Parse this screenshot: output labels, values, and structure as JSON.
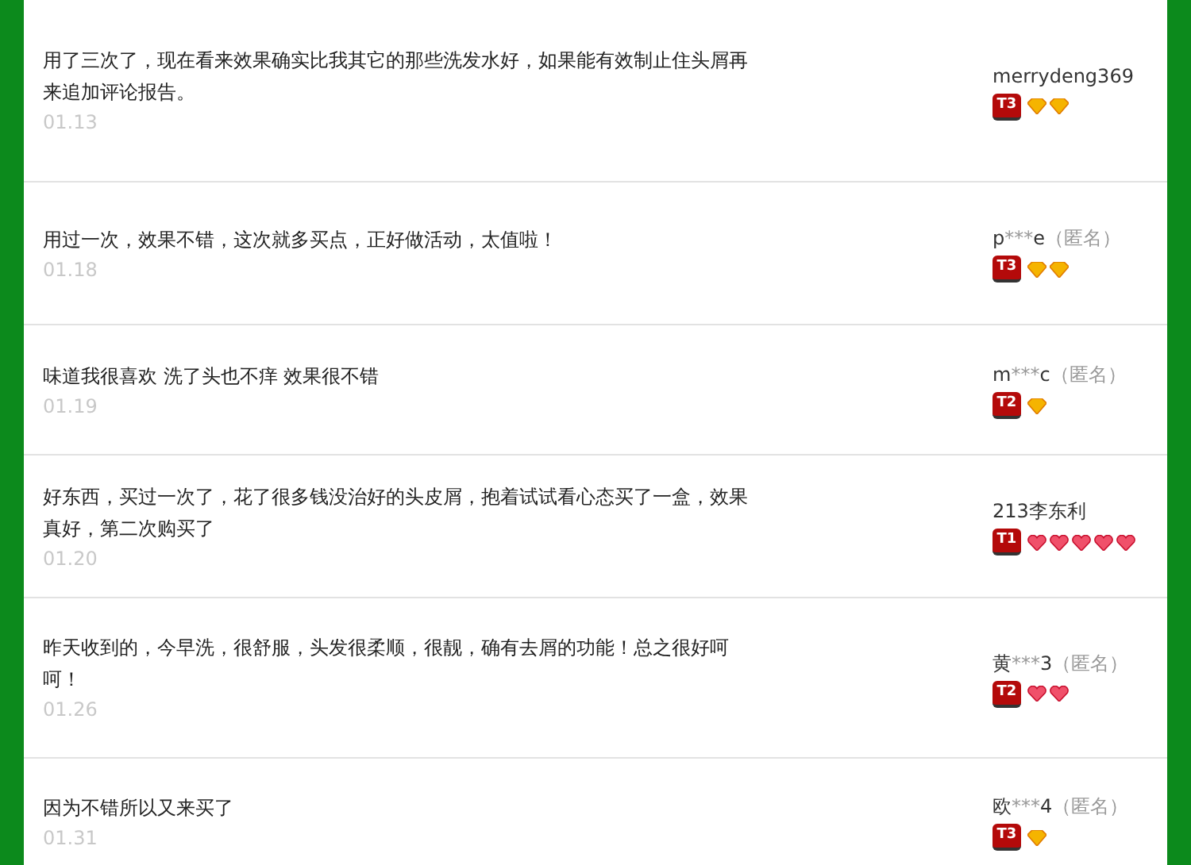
{
  "reviews": [
    {
      "text": "用了三次了，现在看来效果确实比我其它的那些洗发水好，如果能有效制止住头屑再来追加评论报告。",
      "date": "01.13",
      "user": {
        "name": "merrydeng369"
      },
      "badge": "T3",
      "credit_icons": [
        {
          "kind": "diamond"
        },
        {
          "kind": "diamond"
        }
      ]
    },
    {
      "text": "用过一次，效果不错，这次就多买点，正好做活动，太值啦！",
      "date": "01.18",
      "user": {
        "name": "p",
        "mask": "***",
        "name_end": "e",
        "anonymous": "（匿名）"
      },
      "badge": "T3",
      "credit_icons": [
        {
          "kind": "diamond"
        },
        {
          "kind": "diamond"
        }
      ]
    },
    {
      "text": "味道我很喜欢 洗了头也不痒 效果很不错",
      "date": "01.19",
      "user": {
        "name": "m",
        "mask": "***",
        "name_end": "c",
        "anonymous": "（匿名）"
      },
      "badge": "T2",
      "credit_icons": [
        {
          "kind": "diamond"
        }
      ]
    },
    {
      "text": "好东西，买过一次了，花了很多钱没治好的头皮屑，抱着试试看心态买了一盒，效果真好，第二次购买了",
      "date": "01.20",
      "user": {
        "name": "213李东利"
      },
      "badge": "T1",
      "credit_icons": [
        {
          "kind": "heart"
        },
        {
          "kind": "heart"
        },
        {
          "kind": "heart"
        },
        {
          "kind": "heart"
        },
        {
          "kind": "heart"
        }
      ]
    },
    {
      "text": "昨天收到的，今早洗，很舒服，头发很柔顺，很靓，确有去屑的功能！总之很好呵呵！",
      "date": "01.26",
      "user": {
        "name": "黄",
        "mask": "***",
        "name_end": "3",
        "anonymous": "（匿名）"
      },
      "badge": "T2",
      "credit_icons": [
        {
          "kind": "heart"
        },
        {
          "kind": "heart"
        }
      ]
    },
    {
      "text": "因为不错所以又来买了",
      "date": "01.31",
      "user": {
        "name": "欧",
        "mask": "***",
        "name_end": "4",
        "anonymous": "（匿名）"
      },
      "badge": "T3",
      "credit_icons": [
        {
          "kind": "diamond"
        }
      ]
    }
  ]
}
